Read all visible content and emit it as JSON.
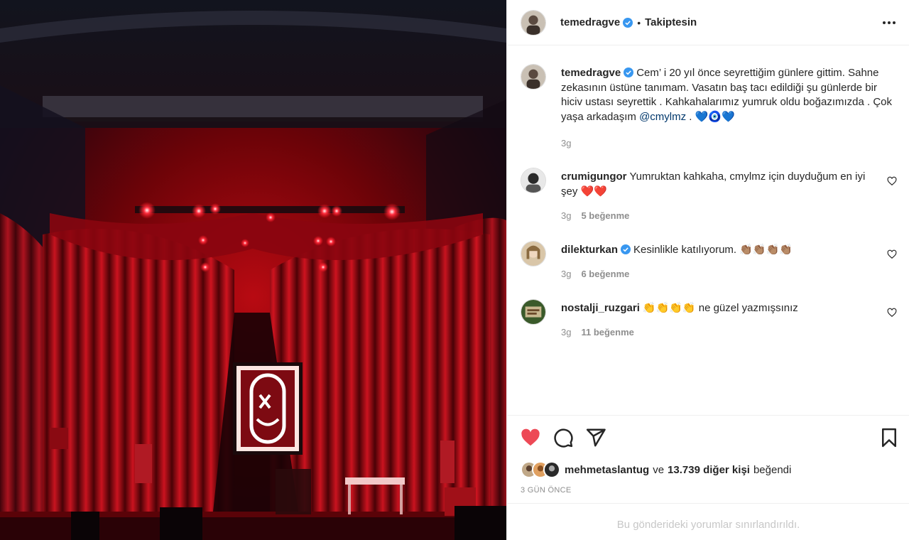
{
  "post": {
    "author": "temedragve",
    "follow_state": "Takiptesin",
    "separator": "•",
    "verified": true
  },
  "caption": {
    "username": "temedragve",
    "text_before_mention": "Cem’ i 20 yıl önce seyrettiğim günlere gittim. Sahne zekasının üstüne tanımam. Vasatın baş tacı edildiği şu günlerde bir hiciv ustası seyrettik . Kahkahalarımız yumruk oldu boğazımızda . Çok yaşa arkadaşım",
    "mention": "@cmylmz",
    "text_after_mention": " . 💙🧿💙",
    "time": "3g"
  },
  "comments": [
    {
      "username": "crumigungor",
      "verified": false,
      "text": "Yumruktan kahkaha, cmylmz için duyduğum en iyi şey ❤️❤️",
      "time": "3g",
      "likes": "5 beğenme"
    },
    {
      "username": "dilekturkan",
      "verified": true,
      "text": "Kesinlikle katılıyorum. 👏🏽👏🏽👏🏽👏🏽",
      "time": "3g",
      "likes": "6 beğenme"
    },
    {
      "username": "nostalji_ruzgari",
      "verified": false,
      "text": "👏👏👏👏 ne güzel yazmışsınız",
      "time": "3g",
      "likes": "11 beğenme"
    }
  ],
  "likes": {
    "first_liker": "mehmetaslantug",
    "connector": "ve",
    "others": "13.739 diğer kişi",
    "suffix": "beğendi"
  },
  "date": "3 GÜN ÖNCE",
  "restricted_notice": "Bu gönderideki yorumlar sınırlandırıldı.",
  "icons": {
    "like": "heart-filled-icon",
    "comment": "comment-bubble-icon",
    "share": "paper-plane-icon",
    "save": "bookmark-icon",
    "more": "more-horizontal-icon",
    "verified": "verified-badge-icon"
  },
  "colors": {
    "liked_heart": "#ed4956",
    "verified_blue": "#3897f0",
    "muted_text": "#8e8e8e",
    "mention": "#00376b"
  }
}
